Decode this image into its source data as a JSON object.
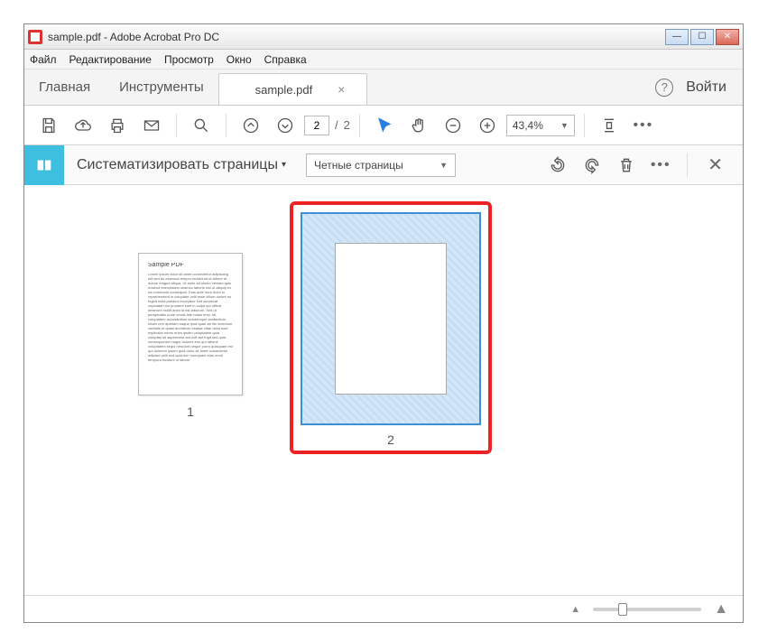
{
  "window": {
    "title": "sample.pdf - Adobe Acrobat Pro DC"
  },
  "menu": {
    "file": "Файл",
    "edit": "Редактирование",
    "view": "Просмотр",
    "window": "Окно",
    "help": "Справка"
  },
  "tabs": {
    "home": "Главная",
    "tools": "Инструменты",
    "doc": "sample.pdf",
    "close_glyph": "×",
    "signin": "Войти",
    "help_glyph": "?"
  },
  "toolbar": {
    "page_current": "2",
    "page_total": "2",
    "page_sep": "/",
    "zoom": "43,4%",
    "more_glyph": "•••"
  },
  "organize": {
    "title": "Систематизировать страницы",
    "caret": "▾",
    "filter": "Четные страницы",
    "more_glyph": "•••",
    "close_glyph": "✕"
  },
  "pages": {
    "p1_label": "1",
    "p2_label": "2",
    "p1_heading": "Sample PDF"
  },
  "status": {
    "mountain_small": "▲",
    "mountain_large": "▲"
  }
}
